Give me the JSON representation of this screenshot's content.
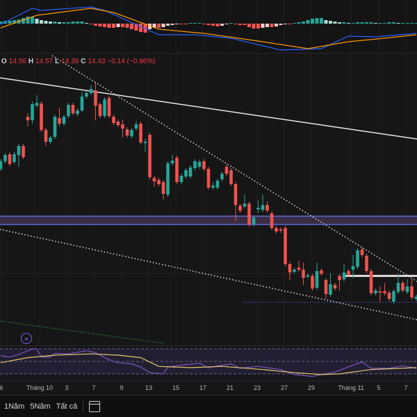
{
  "legend": {
    "o_label": "O",
    "o": "14.56",
    "h_label": "H",
    "h": "14.57",
    "l_label": "L",
    "l": "14.39",
    "c_label": "C",
    "c": "14.43",
    "change": "−0.14 (−0.96%)"
  },
  "time_axis": [
    "6",
    "Tháng 10",
    "3",
    "7",
    "9",
    "13",
    "15",
    "17",
    "21",
    "23",
    "27",
    "29",
    "Tháng 11",
    "5",
    "7"
  ],
  "toolbar": {
    "range_1y": "1Năm",
    "range_5y": "5Năm",
    "range_all": "Tất cả",
    "date_range_icon": "calendar-goto-icon"
  },
  "colors": {
    "up": "#26a69a",
    "down": "#ef5350",
    "background": "#161616",
    "macd_line": "#2962ff",
    "signal_line": "#ff9800",
    "rsi_line": "#7e57c2",
    "rsi_ma": "#e8c86a",
    "band": "#5b6bd6"
  },
  "chart_data": [
    {
      "type": "candlestick",
      "fields": [
        "open",
        "high",
        "low",
        "close"
      ],
      "candles": [
        [
          17.97,
          18.25,
          17.91,
          18.19
        ],
        [
          18.19,
          18.43,
          18.13,
          18.37
        ],
        [
          18.39,
          18.45,
          18.05,
          18.11
        ],
        [
          18.17,
          18.47,
          18.11,
          18.39
        ],
        [
          18.37,
          18.69,
          18.03,
          18.63
        ],
        [
          18.63,
          18.69,
          18.25,
          18.31
        ],
        [
          19.47,
          19.57,
          19.19,
          19.37
        ],
        [
          19.37,
          19.91,
          19.27,
          19.83
        ],
        [
          19.79,
          20.09,
          19.73,
          19.87
        ],
        [
          19.85,
          19.91,
          19.03,
          19.09
        ],
        [
          19.09,
          19.15,
          18.63,
          18.75
        ],
        [
          18.75,
          18.93,
          18.69,
          18.87
        ],
        [
          18.89,
          19.53,
          18.83,
          19.47
        ],
        [
          19.43,
          19.73,
          19.21,
          19.27
        ],
        [
          19.27,
          19.53,
          19.21,
          19.47
        ],
        [
          19.49,
          19.87,
          19.43,
          19.81
        ],
        [
          19.81,
          19.87,
          19.51,
          19.57
        ],
        [
          19.55,
          19.71,
          19.49,
          19.65
        ],
        [
          19.65,
          20.19,
          19.59,
          20.05
        ],
        [
          20.05,
          20.21,
          19.99,
          20.15
        ],
        [
          20.15,
          20.39,
          20.09,
          20.27
        ],
        [
          20.23,
          20.47,
          19.37,
          19.79
        ],
        [
          19.83,
          19.89,
          19.43,
          19.49
        ],
        [
          19.49,
          20.03,
          19.43,
          19.97
        ],
        [
          20.01,
          20.07,
          19.43,
          19.49
        ],
        [
          19.47,
          19.53,
          19.23,
          19.29
        ],
        [
          19.33,
          19.39,
          19.17,
          19.23
        ],
        [
          19.25,
          19.39,
          18.89,
          19.13
        ],
        [
          19.11,
          19.17,
          18.87,
          18.93
        ],
        [
          18.91,
          19.15,
          18.85,
          19.09
        ],
        [
          19.13,
          19.35,
          19.07,
          19.25
        ],
        [
          19.27,
          19.33,
          18.67,
          18.73
        ],
        [
          18.71,
          18.83,
          18.47,
          18.75
        ],
        [
          18.95,
          19.01,
          17.67,
          17.73
        ],
        [
          17.71,
          17.77,
          17.45,
          17.61
        ],
        [
          17.65,
          17.71,
          17.47,
          17.53
        ],
        [
          17.59,
          17.65,
          17.09,
          17.25
        ],
        [
          17.23,
          18.19,
          17.17,
          18.13
        ],
        [
          18.13,
          18.37,
          18.07,
          18.21
        ],
        [
          18.29,
          18.35,
          17.53,
          17.59
        ],
        [
          17.59,
          17.83,
          17.53,
          17.77
        ],
        [
          17.75,
          17.99,
          17.69,
          17.93
        ],
        [
          17.75,
          18.07,
          17.69,
          18.01
        ],
        [
          17.99,
          18.25,
          17.93,
          18.19
        ],
        [
          18.03,
          18.23,
          17.97,
          18.17
        ],
        [
          18.19,
          18.25,
          17.91,
          17.97
        ],
        [
          17.97,
          18.03,
          17.37,
          17.43
        ],
        [
          17.43,
          17.59,
          17.37,
          17.49
        ],
        [
          17.43,
          17.69,
          17.37,
          17.63
        ],
        [
          17.67,
          17.89,
          17.61,
          17.83
        ],
        [
          18.03,
          18.09,
          17.77,
          17.83
        ],
        [
          17.93,
          17.99,
          17.49,
          17.53
        ],
        [
          17.53,
          17.59,
          16.47,
          16.93
        ],
        [
          16.91,
          16.97,
          16.71,
          16.77
        ],
        [
          16.89,
          17.23,
          16.83,
          16.97
        ],
        [
          16.97,
          17.03,
          16.31,
          16.37
        ],
        [
          16.37,
          16.63,
          16.31,
          16.57
        ],
        [
          16.81,
          17.07,
          16.71,
          16.85
        ],
        [
          16.79,
          17.23,
          16.73,
          16.93
        ],
        [
          16.93,
          17.03,
          16.71,
          16.77
        ],
        [
          16.69,
          16.75,
          16.21,
          16.27
        ],
        [
          16.27,
          16.33,
          16.11,
          16.17
        ],
        [
          16.23,
          16.29,
          16.13,
          16.19
        ],
        [
          16.27,
          16.33,
          15.17,
          15.23
        ],
        [
          15.23,
          15.29,
          14.77,
          14.99
        ],
        [
          15.01,
          15.13,
          14.95,
          15.07
        ],
        [
          15.13,
          15.33,
          15.01,
          15.07
        ],
        [
          15.07,
          15.27,
          14.63,
          14.83
        ],
        [
          14.87,
          14.97,
          14.81,
          14.91
        ],
        [
          14.89,
          14.95,
          14.47,
          14.53
        ],
        [
          14.55,
          15.27,
          14.49,
          15.03
        ],
        [
          15.05,
          15.11,
          14.89,
          14.95
        ],
        [
          14.77,
          14.83,
          14.23,
          14.37
        ],
        [
          14.35,
          14.97,
          14.29,
          14.65
        ],
        [
          14.63,
          14.69,
          14.47,
          14.53
        ],
        [
          14.89,
          14.95,
          14.47,
          14.77
        ],
        [
          14.79,
          15.23,
          14.73,
          14.99
        ],
        [
          15.03,
          15.09,
          14.85,
          14.91
        ],
        [
          15.07,
          15.49,
          14.83,
          15.17
        ],
        [
          15.15,
          15.69,
          15.09,
          15.63
        ],
        [
          15.65,
          15.71,
          15.43,
          15.49
        ],
        [
          15.47,
          15.53,
          14.97,
          15.03
        ],
        [
          15.03,
          15.09,
          14.33,
          14.39
        ],
        [
          14.39,
          14.53,
          14.33,
          14.47
        ],
        [
          14.45,
          14.59,
          14.13,
          14.41
        ],
        [
          14.45,
          14.69,
          14.33,
          14.39
        ],
        [
          14.41,
          14.47,
          14.17,
          14.23
        ],
        [
          14.15,
          14.51,
          14.09,
          14.45
        ],
        [
          14.43,
          14.97,
          14.37,
          14.69
        ],
        [
          14.69,
          14.75,
          14.41,
          14.47
        ],
        [
          14.43,
          14.79,
          14.37,
          14.59
        ],
        [
          14.59,
          14.83,
          14.21,
          14.27
        ],
        [
          14.23,
          14.35,
          14.17,
          14.29
        ]
      ],
      "support_zone": [
        16.37,
        16.61
      ],
      "grid": true
    },
    {
      "type": "bar+line",
      "indicator": "MACD",
      "histogram": [
        0.03,
        0.04,
        0.04,
        0.05,
        0.06,
        0.08,
        0.1,
        0.1,
        0.07,
        0.05,
        0.04,
        0.03,
        0.03,
        0.02,
        0.02,
        0.02,
        0.03,
        0.03,
        0.03,
        0.01,
        -0.01,
        -0.03,
        -0.04,
        -0.05,
        -0.06,
        -0.06,
        -0.05,
        -0.05,
        -0.06,
        -0.08,
        -0.1,
        -0.12,
        -0.13,
        -0.08,
        -0.06,
        -0.06,
        -0.05,
        -0.03,
        -0.02,
        -0.01,
        -0.01,
        -0.01,
        0.01,
        0.01,
        0.01,
        -0.01,
        -0.02,
        -0.03,
        -0.04,
        -0.03,
        -0.01,
        0.01,
        -0.01,
        -0.02,
        -0.02,
        -0.05,
        -0.07,
        -0.07,
        -0.06,
        -0.05,
        -0.05,
        -0.04,
        -0.02,
        -0.01,
        -0.01,
        0.01,
        0.02,
        0.03,
        0.05,
        0.07,
        0.08,
        0.08,
        0.05,
        0.04,
        0.03,
        0.02,
        0.02,
        0.01,
        0.01,
        0.02,
        0.02,
        0.02,
        0.02,
        0.01,
        0.01,
        0.01,
        0.02,
        0.02,
        0.01,
        0.01,
        0.01,
        0.01,
        0.01
      ],
      "macd": [
        [
          0,
          -0.01
        ],
        [
          7,
          0.22
        ],
        [
          9,
          0.19
        ],
        [
          20,
          0.24
        ],
        [
          23,
          0.19
        ],
        [
          35,
          -0.16
        ],
        [
          43,
          -0.16
        ],
        [
          51,
          -0.21
        ],
        [
          62,
          -0.38
        ],
        [
          71,
          -0.36
        ],
        [
          77,
          -0.18
        ],
        [
          83,
          -0.19
        ],
        [
          92,
          -0.14
        ]
      ],
      "signal": [
        [
          0,
          -0.06
        ],
        [
          8,
          0.12
        ],
        [
          20,
          0.22
        ],
        [
          25,
          0.16
        ],
        [
          35,
          -0.08
        ],
        [
          45,
          -0.14
        ],
        [
          58,
          -0.26
        ],
        [
          68,
          -0.36
        ],
        [
          77,
          -0.26
        ],
        [
          85,
          -0.21
        ],
        [
          92,
          -0.16
        ]
      ]
    },
    {
      "type": "line",
      "indicator": "RSI",
      "levels": [
        70,
        50,
        30
      ],
      "rsi": [
        [
          0,
          59
        ],
        [
          2,
          57
        ],
        [
          4,
          61
        ],
        [
          7,
          70
        ],
        [
          8,
          70
        ],
        [
          9,
          57
        ],
        [
          11,
          57
        ],
        [
          12,
          63
        ],
        [
          15,
          62
        ],
        [
          19,
          67
        ],
        [
          21,
          64
        ],
        [
          23,
          56
        ],
        [
          25,
          50
        ],
        [
          26,
          48
        ],
        [
          29,
          46
        ],
        [
          31,
          41
        ],
        [
          33,
          32
        ],
        [
          36,
          30
        ],
        [
          37,
          41
        ],
        [
          40,
          44
        ],
        [
          44,
          47
        ],
        [
          46,
          40
        ],
        [
          49,
          44
        ],
        [
          51,
          46
        ],
        [
          53,
          39
        ],
        [
          57,
          42
        ],
        [
          62,
          37
        ],
        [
          65,
          29
        ],
        [
          69,
          26
        ],
        [
          71,
          29
        ],
        [
          74,
          33
        ],
        [
          78,
          44
        ],
        [
          80,
          49
        ],
        [
          82,
          39
        ],
        [
          86,
          39
        ],
        [
          89,
          43
        ],
        [
          92,
          39
        ]
      ],
      "rsi_ma": [
        [
          0,
          48
        ],
        [
          6,
          56
        ],
        [
          12,
          60
        ],
        [
          20,
          62
        ],
        [
          26,
          60
        ],
        [
          31,
          56
        ],
        [
          35,
          42
        ],
        [
          42,
          40
        ],
        [
          49,
          42
        ],
        [
          58,
          37
        ],
        [
          65,
          32
        ],
        [
          71,
          29
        ],
        [
          75,
          30
        ],
        [
          82,
          37
        ],
        [
          92,
          40
        ]
      ]
    }
  ]
}
